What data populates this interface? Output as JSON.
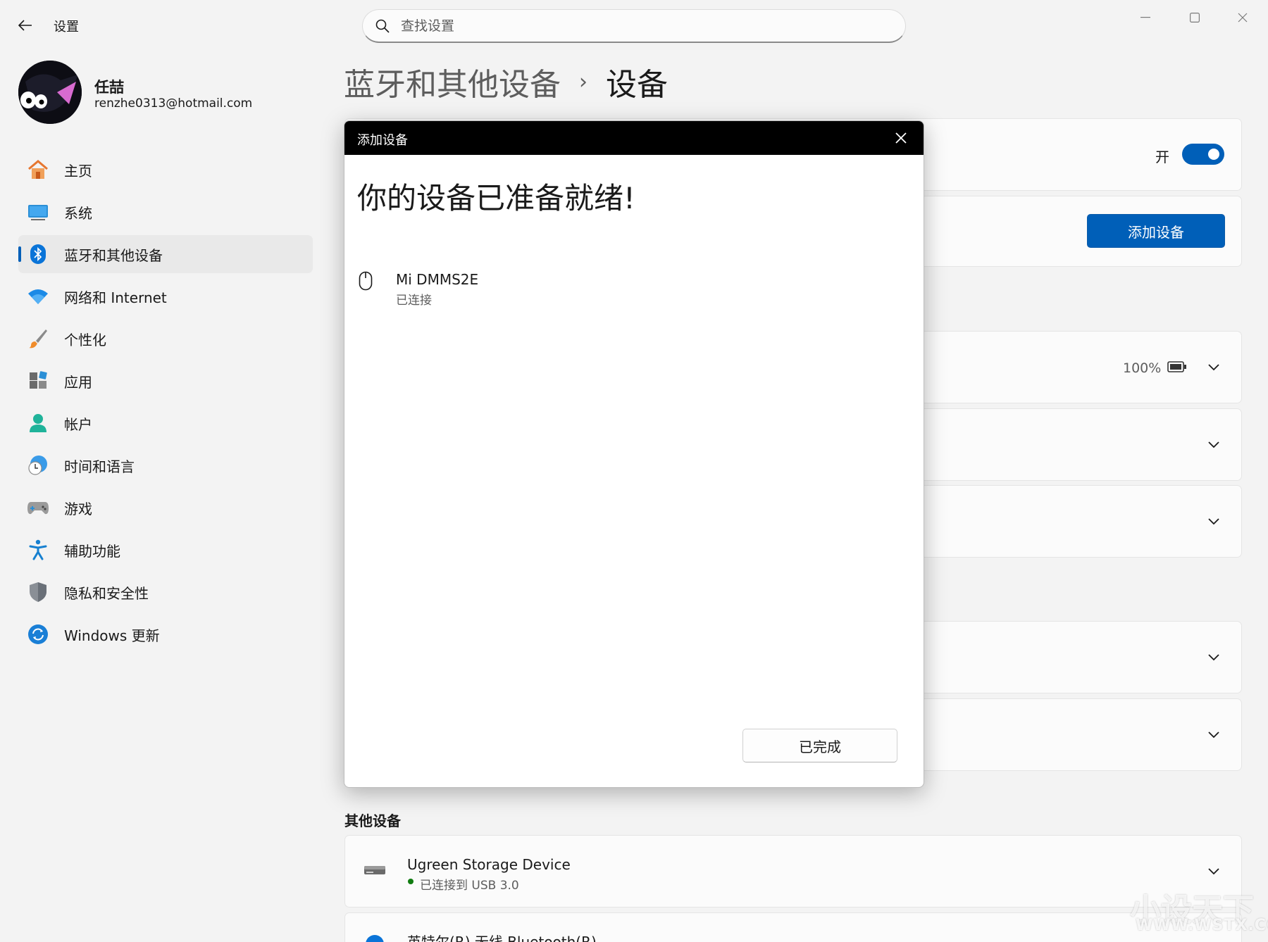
{
  "app": {
    "title": "设置"
  },
  "search": {
    "placeholder": "查找设置"
  },
  "user": {
    "name": "任喆",
    "email": "renzhe0313@hotmail.com"
  },
  "sidebar": {
    "items": [
      {
        "label": "主页",
        "icon": "home-icon"
      },
      {
        "label": "系统",
        "icon": "system-icon"
      },
      {
        "label": "蓝牙和其他设备",
        "icon": "bluetooth-icon",
        "active": true
      },
      {
        "label": "网络和 Internet",
        "icon": "wifi-icon"
      },
      {
        "label": "个性化",
        "icon": "brush-icon"
      },
      {
        "label": "应用",
        "icon": "apps-icon"
      },
      {
        "label": "帐户",
        "icon": "account-icon"
      },
      {
        "label": "时间和语言",
        "icon": "clock-globe-icon"
      },
      {
        "label": "游戏",
        "icon": "gamepad-icon"
      },
      {
        "label": "辅助功能",
        "icon": "accessibility-icon"
      },
      {
        "label": "隐私和安全性",
        "icon": "shield-icon"
      },
      {
        "label": "Windows 更新",
        "icon": "update-icon"
      }
    ]
  },
  "breadcrumb": {
    "parent": "蓝牙和其他设备",
    "separator": "›",
    "current": "设备"
  },
  "bluetooth": {
    "toggle_label": "开",
    "toggle_on": true
  },
  "add_device_button": "添加设备",
  "battery": {
    "percent": "100%"
  },
  "other_devices": {
    "title": "其他设备",
    "items": [
      {
        "name": "Ugreen Storage Device",
        "status": "已连接到 USB 3.0"
      },
      {
        "name": "英特尔(R) 无线 Bluetooth(R)"
      }
    ]
  },
  "dialog": {
    "title": "添加设备",
    "heading": "你的设备已准备就绪!",
    "device": {
      "name": "Mi DMMS2E",
      "status": "已连接"
    },
    "done_label": "已完成"
  },
  "watermark": {
    "text": "小设天下",
    "url": "WWW.WSTX.COM"
  },
  "colors": {
    "accent": "#005fb8",
    "connected": "#107c10",
    "background": "#f3f3f3"
  }
}
